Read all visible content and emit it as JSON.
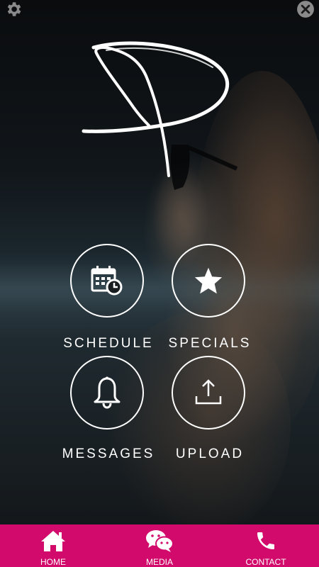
{
  "top_bar": {
    "settings_icon": "gear-icon",
    "close_icon": "close-circle-icon"
  },
  "logo": {
    "icon": "script-p-logo"
  },
  "menu": {
    "tiles": [
      {
        "label": "SCHEDULE",
        "icon": "calendar-clock-icon"
      },
      {
        "label": "SPECIALS",
        "icon": "star-icon"
      },
      {
        "label": "MESSAGES",
        "icon": "bell-icon"
      },
      {
        "label": "UPLOAD",
        "icon": "upload-icon"
      }
    ]
  },
  "tabbar": {
    "background": "#d10a6b",
    "tabs": [
      {
        "label": "HOME",
        "icon": "home-icon"
      },
      {
        "label": "MEDIA",
        "icon": "chat-bubbles-icon"
      },
      {
        "label": "CONTACT",
        "icon": "phone-icon"
      }
    ]
  }
}
